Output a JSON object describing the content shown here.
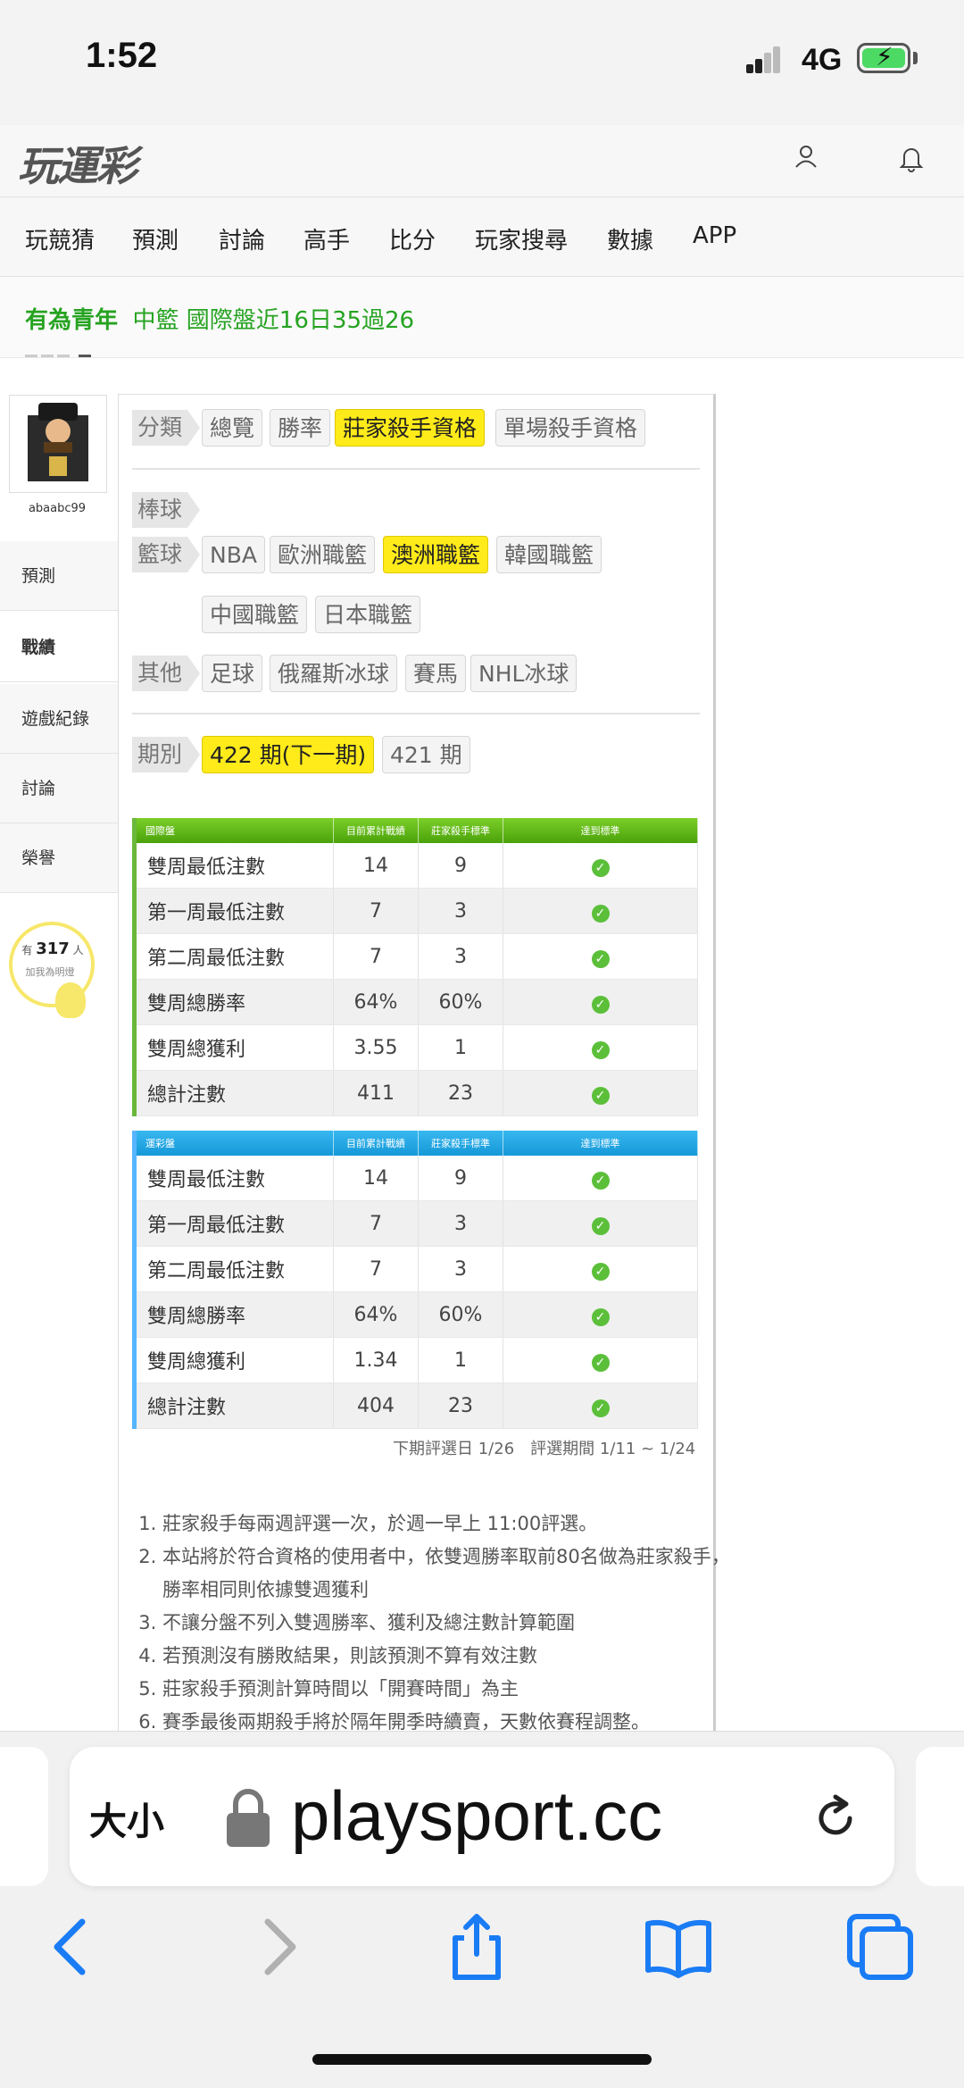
{
  "status": {
    "time": "1:52",
    "network": "4G"
  },
  "header": {
    "logo": "玩運彩"
  },
  "nav": {
    "items": [
      "玩競猜",
      "預測",
      "討論",
      "高手",
      "比分",
      "玩家搜尋",
      "數據",
      "APP"
    ]
  },
  "ticker": {
    "name": "有為青年",
    "text": "中籃 國際盤近16日35過26"
  },
  "sidebar": {
    "username": "abaabc99",
    "items": [
      "預測",
      "戰績",
      "遊戲紀錄",
      "討論",
      "榮譽"
    ],
    "fans": {
      "prefix": "有",
      "count": "317",
      "suffix": "人",
      "caption": "加我為明燈"
    }
  },
  "filters": {
    "category_label": "分類",
    "category_tabs": [
      "總覽",
      "勝率",
      "莊家殺手資格",
      "單場殺手資格"
    ],
    "baseball_label": "棒球",
    "basketball_label": "籃球",
    "basketball_tabs": [
      "NBA",
      "歐洲職籃",
      "澳洲職籃",
      "韓國職籃",
      "中國職籃",
      "日本職籃"
    ],
    "other_label": "其他",
    "other_tabs": [
      "足球",
      "俄羅斯冰球",
      "賽馬",
      "NHL冰球"
    ],
    "period_label": "期別",
    "period_tabs": [
      "422 期(下一期)",
      "421 期"
    ]
  },
  "table_international": {
    "headers": [
      "國際盤",
      "目前累計戰績",
      "莊家殺手標準",
      "達到標準"
    ],
    "rows": [
      [
        "雙周最低注數",
        "14",
        "9"
      ],
      [
        "第一周最低注數",
        "7",
        "3"
      ],
      [
        "第二周最低注數",
        "7",
        "3"
      ],
      [
        "雙周總勝率",
        "64%",
        "60%"
      ],
      [
        "雙周總獲利",
        "3.55",
        "1"
      ],
      [
        "總計注數",
        "411",
        "23"
      ]
    ]
  },
  "table_lottery": {
    "headers": [
      "運彩盤",
      "目前累計戰績",
      "莊家殺手標準",
      "達到標準"
    ],
    "rows": [
      [
        "雙周最低注數",
        "14",
        "9"
      ],
      [
        "第一周最低注數",
        "7",
        "3"
      ],
      [
        "第二周最低注數",
        "7",
        "3"
      ],
      [
        "雙周總勝率",
        "64%",
        "60%"
      ],
      [
        "雙周總獲利",
        "1.34",
        "1"
      ],
      [
        "總計注數",
        "404",
        "23"
      ]
    ]
  },
  "period_note": "下期評選日 1/26　評選期間 1/11 ~ 1/24",
  "rules": [
    "莊家殺手每兩週評選一次，於週一早上 11:00評選。",
    "本站將於符合資格的使用者中，依雙週勝率取前80名做為莊家殺手，勝率相同則依據雙週獲利",
    "不讓分盤不列入雙週勝率、獲利及總注數計算範圍",
    "若預測沒有勝敗結果，則該預測不算有效注數",
    "莊家殺手預測計算時間以「開賽時間」為主",
    "賽季最後兩期殺手將於隔年開季時續賣，天數依賽程調整。"
  ],
  "browser": {
    "size_label": "大小",
    "url": "playsport.cc"
  }
}
